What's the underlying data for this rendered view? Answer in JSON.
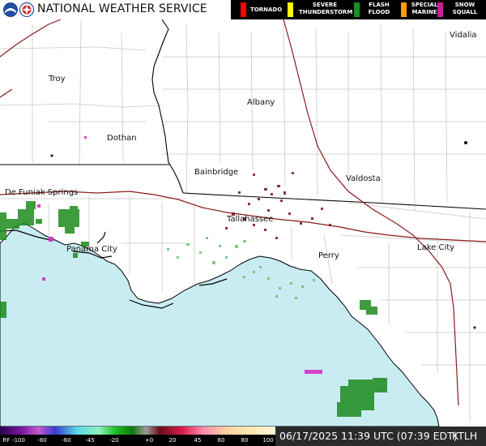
{
  "header": {
    "title": "NATIONAL WEATHER SERVICE",
    "noaa_logo": "noaa-logo-icon",
    "nws_logo": "nws-logo-icon"
  },
  "legend": [
    {
      "label": "TORNADO",
      "color": "#ff0000"
    },
    {
      "label": "SEVERE\nTHUNDERSTORM",
      "color": "#ffff00"
    },
    {
      "label": "FLASH\nFLOOD",
      "color": "#1a8f1a"
    },
    {
      "label": "SPECIAL\nMARINE",
      "color": "#ff9f00"
    },
    {
      "label": "SNOW\nSQUALL",
      "color": "#c8209c"
    }
  ],
  "cities": [
    {
      "name": "Troy"
    },
    {
      "name": "Albany"
    },
    {
      "name": "Vidalia"
    },
    {
      "name": "Dothan"
    },
    {
      "name": "Bainbridge"
    },
    {
      "name": "Valdosta"
    },
    {
      "name": "De Funiak Springs"
    },
    {
      "name": "Tallahassee"
    },
    {
      "name": "Panama City"
    },
    {
      "name": "Perry"
    },
    {
      "name": "Lake City"
    }
  ],
  "colorbar": {
    "rf_label": "RF",
    "ticks": [
      "-100",
      "-80",
      "-60",
      "-45",
      "-20",
      "+0",
      "20",
      "45",
      "60",
      "80",
      "100"
    ]
  },
  "status": {
    "timestamp": "06/17/2025 11:39 UTC (07:39 EDT)",
    "station": "KTLH"
  },
  "colors": {
    "water": "#c8ecf2",
    "land": "#ffffff",
    "state_border": "#000000",
    "county_line": "#c8c8c8",
    "highway": "#8b1a1a",
    "coast": "#000000"
  }
}
